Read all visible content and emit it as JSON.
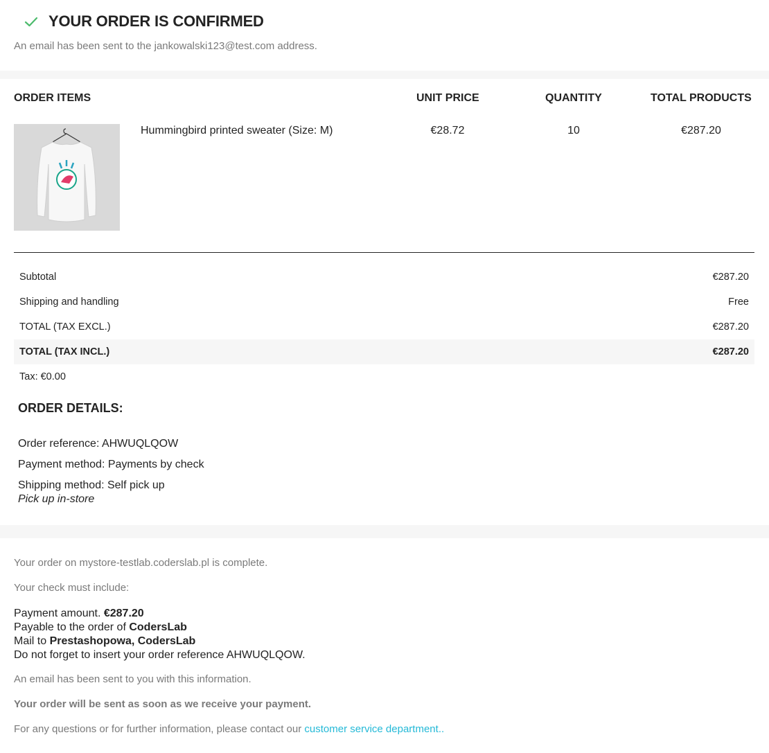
{
  "confirmation": {
    "title": "YOUR ORDER IS CONFIRMED",
    "email_note": "An email has been sent to the jankowalski123@test.com address."
  },
  "items_table": {
    "headers": {
      "items": "ORDER ITEMS",
      "unit_price": "UNIT PRICE",
      "quantity": "QUANTITY",
      "total": "TOTAL PRODUCTS"
    },
    "rows": [
      {
        "name": "Hummingbird printed sweater (Size: M)",
        "unit_price": "€28.72",
        "quantity": "10",
        "total": "€287.20"
      }
    ]
  },
  "summary": {
    "subtotal_label": "Subtotal",
    "subtotal_value": "€287.20",
    "shipping_label": "Shipping and handling",
    "shipping_value": "Free",
    "tax_excl_label": "TOTAL (TAX EXCL.)",
    "tax_excl_value": "€287.20",
    "tax_incl_label": "TOTAL (TAX INCL.)",
    "tax_incl_value": "€287.20",
    "tax_line": "Tax: €0.00"
  },
  "order_details": {
    "heading": "ORDER DETAILS:",
    "reference": "Order reference: AHWUQLQOW",
    "payment_method": "Payment method: Payments by check",
    "shipping_method": "Shipping method: Self pick up",
    "shipping_note": "Pick up in-store"
  },
  "payment_info": {
    "complete_note": "Your order on mystore-testlab.coderslab.pl is complete.",
    "check_intro": "Your check must include:",
    "amount_label": "Payment amount. ",
    "amount_value": "€287.20",
    "payable_label": "Payable to the order of ",
    "payable_value": "CodersLab",
    "mail_label": "Mail to ",
    "mail_value": "Prestashopowa, CodersLab",
    "reference_reminder": "Do not forget to insert your order reference AHWUQLQOW.",
    "email_info": "An email has been sent to you with this information.",
    "shipping_notice": "Your order will be sent as soon as we receive your payment.",
    "contact_text": "For any questions or for further information, please contact our ",
    "contact_link": "customer service department",
    "contact_suffix": ".."
  },
  "colors": {
    "accent_link": "#24b9d7",
    "check_green": "#4cbb6c",
    "text_dark": "#232323",
    "text_muted": "#7a7a7a"
  }
}
